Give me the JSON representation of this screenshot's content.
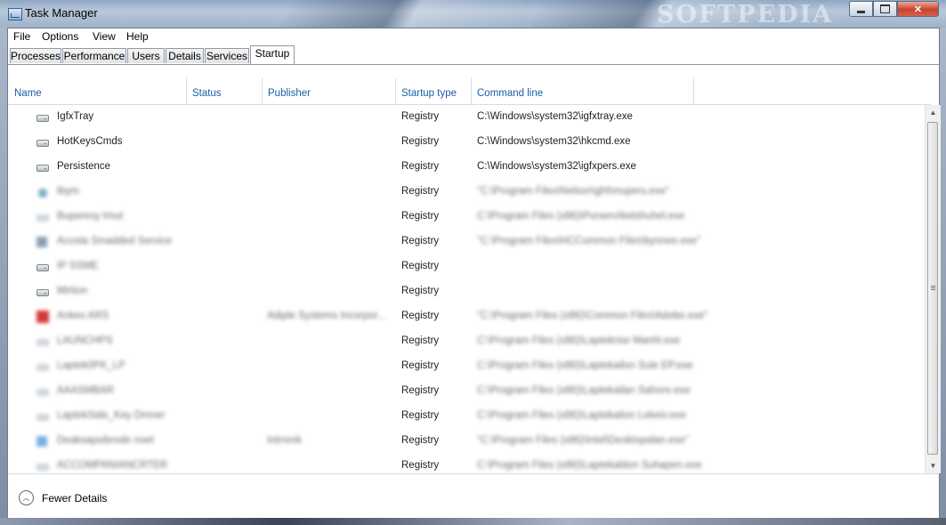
{
  "window": {
    "title": "Task Manager",
    "watermark": "SOFTPEDIA",
    "controls": {
      "minimize": "",
      "maximize": "",
      "close": "✕"
    }
  },
  "menu": [
    "File",
    "Options",
    "View",
    "Help"
  ],
  "tabs": [
    "Processes",
    "Performance",
    "Users",
    "Details",
    "Services",
    "Startup"
  ],
  "active_tab": "Startup",
  "columns": [
    "Name",
    "Status",
    "Publisher",
    "Startup type",
    "Command line"
  ],
  "rows": [
    {
      "name": "IgfxTray",
      "publisher": "",
      "type": "Registry",
      "cmd": "C:\\Windows\\system32\\igfxtray.exe",
      "icon": "drive-icon",
      "blurred": false
    },
    {
      "name": "HotKeysCmds",
      "publisher": "",
      "type": "Registry",
      "cmd": "C:\\Windows\\system32\\hkcmd.exe",
      "icon": "drive-icon",
      "blurred": false
    },
    {
      "name": "Persistence",
      "publisher": "",
      "type": "Registry",
      "cmd": "C:\\Windows\\system32\\igfxpers.exe",
      "icon": "drive-icon",
      "blurred": false
    },
    {
      "name": "tbym",
      "publisher": "",
      "type": "Registry",
      "cmd": "\"C:\\Program Files\\Nelson\\ght\\mupers.exe\"",
      "icon": "gear-icon",
      "blurred": true
    },
    {
      "name": "Buperesy tmut",
      "publisher": "",
      "type": "Registry",
      "cmd": "C:\\Program Files (x86)\\Pursero\\ketshuhel.exe",
      "icon": "generic-icon",
      "blurred": true
    },
    {
      "name": "Acosta Smadded Service",
      "publisher": "",
      "type": "Registry",
      "cmd": "\"C:\\Program Files\\HCCommon Files\\bynnee.exe\"",
      "icon": "app-icon",
      "blurred": true
    },
    {
      "name": "IP SSME",
      "publisher": "",
      "type": "Registry",
      "cmd": "",
      "icon": "drive-icon",
      "blurred": true
    },
    {
      "name": "Mirtion",
      "publisher": "",
      "type": "Registry",
      "cmd": "",
      "icon": "drive-icon",
      "blurred": true
    },
    {
      "name": "Ankes ARS",
      "publisher": "Adiple Systems Incorpor...",
      "type": "Registry",
      "cmd": "\"C:\\Program Files (x86)\\Common Files\\Adobe.exe\"",
      "icon": "red-icon",
      "blurred": true
    },
    {
      "name": "LAUNCHPS",
      "publisher": "",
      "type": "Registry",
      "cmd": "C:\\Program Files (x86)\\Laptekrise Manhl.exe",
      "icon": "generic-icon",
      "blurred": true
    },
    {
      "name": "Laptek0PK_LP",
      "publisher": "",
      "type": "Registry",
      "cmd": "C:\\Program Files (x86)\\Laptekailon Sule EP.exe",
      "icon": "generic-icon",
      "blurred": true
    },
    {
      "name": "AAASMBAR",
      "publisher": "",
      "type": "Registry",
      "cmd": "C:\\Program Files (x86)\\Laptekailan Sahore.exe",
      "icon": "generic-icon",
      "blurred": true
    },
    {
      "name": "LaptekSide_Key Dmner",
      "publisher": "",
      "type": "Registry",
      "cmd": "C:\\Program Files (x86)\\Laptekalion Lekeiv.exe",
      "icon": "generic-icon",
      "blurred": true
    },
    {
      "name": "Deaksapsibrode noet",
      "publisher": "Intrrenk",
      "type": "Registry",
      "cmd": "\"C:\\Program Files (x86)\\Intel\\Desktopalan.exe\"",
      "icon": "blue-icon",
      "blurred": true
    },
    {
      "name": "ACCOMPANIANCRTER",
      "publisher": "",
      "type": "Registry",
      "cmd": "C:\\Program Files (x86)\\Laptekaldon Suhapen.exe",
      "icon": "generic-icon",
      "blurred": true
    }
  ],
  "footer": {
    "fewer_details_label": "Fewer Details"
  },
  "scrollbar": {
    "up": "▲",
    "down": "▼"
  }
}
